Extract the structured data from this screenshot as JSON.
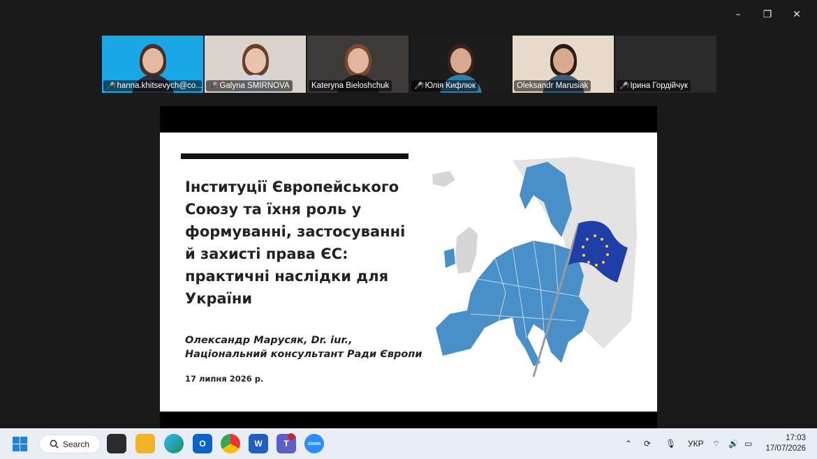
{
  "window": {
    "minimize_glyph": "–",
    "restore_glyph": "❐",
    "close_glyph": "✕"
  },
  "participants": [
    {
      "name": "hanna.khitsevych@co...",
      "muted": true,
      "active": false,
      "bg": "#19a7e6",
      "skin": "#e4b9a0",
      "hair": "#4a2e22",
      "shirt": "#2a2f3a"
    },
    {
      "name": "Galyna SMIRNOVA",
      "muted": true,
      "active": false,
      "bg": "#d8d4cc",
      "skin": "#e6c3ad",
      "hair": "#6b3e2a",
      "shirt": "#cfd7e2"
    },
    {
      "name": "Kateryna Bieloshchuk",
      "muted": false,
      "active": true,
      "bg": "#3e3a38",
      "skin": "#e0b79e",
      "hair": "#7a4a2c",
      "shirt": "#1b1b1e"
    },
    {
      "name": "Юлія Кифлюк",
      "muted": true,
      "active": false,
      "bg": "#1c1c1c",
      "skin": "#d8a88f",
      "hair": "#3a2418",
      "shirt": "#2d7fa8"
    },
    {
      "name": "Oleksandr Marusiak",
      "muted": false,
      "active": false,
      "bg": "#e6dac8",
      "skin": "#d9a98e",
      "hair": "#2a1c14",
      "shirt": "#3d5a76"
    },
    {
      "name": "Ірина Гордійчук",
      "muted": true,
      "active": false,
      "bg": "#2a2a2a",
      "skin": "",
      "hair": "",
      "shirt": ""
    }
  ],
  "slide": {
    "title": "Інституції Європейського Союзу та їхня роль у формуванні, застосуванні й захисті права ЄС: практичні наслідки для України",
    "author_line1": "Олександр Марусяк, Dr. iur.,",
    "author_line2": "Національний консультант Ради Європи",
    "date": "17 липня 2026 р.",
    "map_color": "#4a90c8",
    "flag_color": "#1f3fa8"
  },
  "taskbar": {
    "search_label": "Search",
    "language": "УКР",
    "time": "17:03",
    "date": "17/07/2026"
  }
}
